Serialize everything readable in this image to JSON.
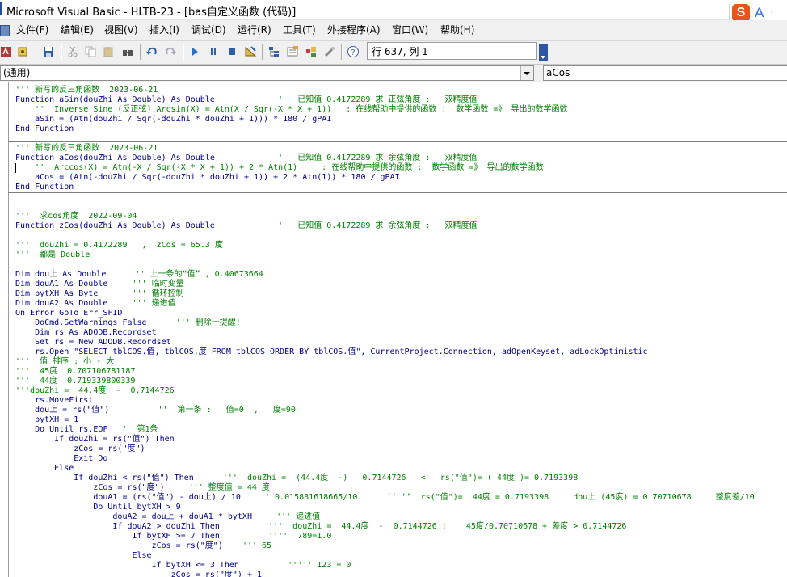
{
  "window": {
    "title": "Microsoft Visual Basic - HLTB-23 - [bas自定义函数 (代码)]"
  },
  "ime": {
    "logo": "S",
    "mode": "A",
    "dot": "·"
  },
  "menu": [
    {
      "label": "文件(F)"
    },
    {
      "label": "编辑(E)"
    },
    {
      "label": "视图(V)"
    },
    {
      "label": "插入(I)"
    },
    {
      "label": "调试(D)"
    },
    {
      "label": "运行(R)"
    },
    {
      "label": "工具(T)"
    },
    {
      "label": "外接程序(A)"
    },
    {
      "label": "窗口(W)"
    },
    {
      "label": "帮助(H)"
    }
  ],
  "toolbar": {
    "position": "行 637, 列 1",
    "icons": [
      "access-view-icon",
      "insert-module-icon",
      "save-icon",
      "cut-icon",
      "copy-icon",
      "paste-icon",
      "find-icon",
      "undo-icon",
      "redo-icon",
      "run-icon",
      "break-icon",
      "reset-icon",
      "design-mode-icon",
      "project-explorer-icon",
      "properties-icon",
      "object-browser-icon",
      "toolbox-icon",
      "help-icon"
    ]
  },
  "combos": {
    "object": "(通用)",
    "procedure": "aCos"
  },
  "code": {
    "lines": [
      [
        [
          "''' 新写的反三角函数  2023-06-21",
          "cm"
        ]
      ],
      [
        [
          "Function aSin(douZhi As Double) As Double             ",
          "kw"
        ],
        [
          "'   已知值 0.4172289 求 正弦角度 :   双精度值",
          "cm"
        ]
      ],
      [
        [
          "    ''  Inverse Sine (反正弦) Arcsin(X) = Atn(X / Sqr(-X * X + 1))   : 在线帮助中提供的函数 :  数学函数 =》 导出的数学函数",
          "cm"
        ]
      ],
      [
        [
          "    aSin = (Atn(douZhi / Sqr(-douZhi * douZhi + 1))) * 180 / gPAI",
          "kw"
        ]
      ],
      [
        [
          "End Function",
          "kw"
        ]
      ],
      [
        [
          "",
          ""
        ]
      ],
      [
        [
          "''' 新写的反三角函数  2023-06-21",
          "cm"
        ]
      ],
      [
        [
          "Function aCos(douZhi As Double) As Double             ",
          "kw"
        ],
        [
          "'   已知值 0.4172289 求 余弦角度 :   双精度值",
          "cm"
        ]
      ],
      [
        [
          "    ''  Arccos(X) = Atn(-X / Sqr(-X * X + 1)) + 2 * Atn(1)     : 在线帮助中提供的函数 :  数学函数 =》 导出的数学函数",
          "cm"
        ]
      ],
      [
        [
          "    aCos = (Atn(-douZhi / Sqr(-douZhi * douZhi + 1)) + 2 * Atn(1)) * 180 / gPAI",
          "kw"
        ]
      ],
      [
        [
          "End Function",
          "kw"
        ]
      ],
      [
        [
          "",
          ""
        ]
      ],
      [
        [
          "",
          ""
        ]
      ],
      [
        [
          "'''  求cos角度  2022-09-04",
          "cm"
        ]
      ],
      [
        [
          "Function zCos(douZhi As Double) As Double             ",
          "kw"
        ],
        [
          "'   已知值 0.4172289 求 余弦角度 :   双精度值",
          "cm"
        ]
      ],
      [
        [
          "",
          ""
        ]
      ],
      [
        [
          "'''  douZhi = 0.4172289   ,  zCos = 65.3 度",
          "cm"
        ]
      ],
      [
        [
          "'''  都是 Double",
          "cm"
        ]
      ],
      [
        [
          "",
          ""
        ]
      ],
      [
        [
          "Dim dou上 As Double     ",
          "kw"
        ],
        [
          "''' 上一条的“值” , 0.40673664",
          "cm"
        ]
      ],
      [
        [
          "Dim douA1 As Double     ",
          "kw"
        ],
        [
          "''' 临时变量",
          "cm"
        ]
      ],
      [
        [
          "Dim bytXH As Byte       ",
          "kw"
        ],
        [
          "''' 循环控制",
          "cm"
        ]
      ],
      [
        [
          "Dim douA2 As Double     ",
          "kw"
        ],
        [
          "''' 递进值",
          "cm"
        ]
      ],
      [
        [
          "On Error GoTo Err_SFID",
          "kw"
        ]
      ],
      [
        [
          "    DoCmd.SetWarnings False      ",
          "kw"
        ],
        [
          "''' 删除一提醒!",
          "cm"
        ]
      ],
      [
        [
          "    Dim rs As ADODB.Recordset",
          "kw"
        ]
      ],
      [
        [
          "    Set rs = New ADODB.Recordset",
          "kw"
        ]
      ],
      [
        [
          "    rs.Open \"SELECT tblCOS.值, tblCOS.度 FROM tblCOS ORDER BY tblCOS.值\", CurrentProject.Connection, adOpenKeyset, adLockOptimistic",
          "kw"
        ]
      ],
      [
        [
          "'''  值 排序 : 小 - 大",
          "cm"
        ]
      ],
      [
        [
          "'''  45度  0.707106781187",
          "cm"
        ]
      ],
      [
        [
          "'''  44度  0.719339800339",
          "cm"
        ]
      ],
      [
        [
          "'''douZhi =  44.4度  -  0.7144726",
          "cm"
        ]
      ],
      [
        [
          "    rs.MoveFirst",
          "kw"
        ]
      ],
      [
        [
          "    dou上 = rs(\"值\")          ",
          "kw"
        ],
        [
          "''' 第一条 :   值=0  ,   度=90",
          "cm"
        ]
      ],
      [
        [
          "    bytXH = 1",
          "kw"
        ]
      ],
      [
        [
          "    Do Until rs.EOF   ",
          "kw"
        ],
        [
          "'  第1条",
          "cm"
        ]
      ],
      [
        [
          "        If douZhi = rs(\"值\") Then",
          "kw"
        ]
      ],
      [
        [
          "            zCos = rs(\"度\")",
          "kw"
        ]
      ],
      [
        [
          "            Exit Do",
          "kw"
        ]
      ],
      [
        [
          "        Else",
          "kw"
        ]
      ],
      [
        [
          "            If douZhi < rs(\"值\") Then      ",
          "kw"
        ],
        [
          "'''  douZhi =  (44.4度  -)   0.7144726   <   rs(\"值\")= ( 44度 )= 0.7193398",
          "cm"
        ]
      ],
      [
        [
          "                zCos = rs(\"度\")     ",
          "kw"
        ],
        [
          "''' 整度值 = 44 度",
          "cm"
        ]
      ],
      [
        [
          "                douA1 = (rs(\"值\") - dou上) / 10     ",
          "kw"
        ],
        [
          "' 0.015881618665/10      ‘’ ‘’  rs(\"值\")=  44度 = 0.7193398     dou上 (45度) = 0.70710678     整度差/10",
          "cm"
        ]
      ],
      [
        [
          "                Do Until bytXH > 9",
          "kw"
        ]
      ],
      [
        [
          "                    douA2 = dou上 + douA1 * bytXH     ",
          "kw"
        ],
        [
          "''' 递进值",
          "cm"
        ]
      ],
      [
        [
          "                    If douA2 > douZhi Then          ",
          "kw"
        ],
        [
          "'''  douZhi =  44.4度  -  0.7144726 :    45度/0.70710678 + 差度 > 0.7144726",
          "cm"
        ]
      ],
      [
        [
          "                        If bytXH >= 7 Then          ",
          "kw"
        ],
        [
          "''''  789=1.0",
          "cm"
        ]
      ],
      [
        [
          "                            zCos = rs(\"度\")    ",
          "kw"
        ],
        [
          "''' 65",
          "cm"
        ]
      ],
      [
        [
          "                        Else",
          "kw"
        ]
      ],
      [
        [
          "                            If bytXH <= 3 Then          ",
          "kw"
        ],
        [
          "''''' 123 = 0",
          "cm"
        ]
      ],
      [
        [
          "                                zCos = rs(\"度\") + 1",
          "kw"
        ]
      ]
    ]
  }
}
